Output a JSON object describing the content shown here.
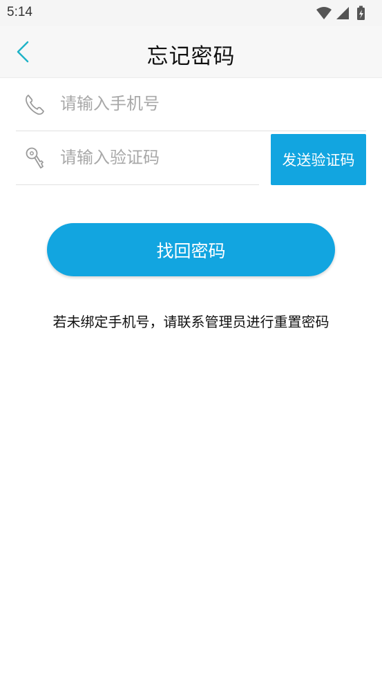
{
  "status_bar": {
    "time": "5:14",
    "icons": [
      "wifi-icon",
      "signal-icon",
      "battery-charging-icon"
    ]
  },
  "header": {
    "title": "忘记密码",
    "back_icon": "chevron-left-icon"
  },
  "form": {
    "phone": {
      "placeholder": "请输入手机号",
      "value": "",
      "icon": "phone-icon"
    },
    "code": {
      "placeholder": "请输入验证码",
      "value": "",
      "icon": "key-icon"
    },
    "send_code_label": "发送验证码"
  },
  "submit_label": "找回密码",
  "hint": "若未绑定手机号，请联系管理员进行重置密码",
  "colors": {
    "accent": "#12a5e0",
    "back_icon": "#1fb3c7",
    "header_bg": "#f7f7f7",
    "placeholder": "#a8a8a8"
  }
}
